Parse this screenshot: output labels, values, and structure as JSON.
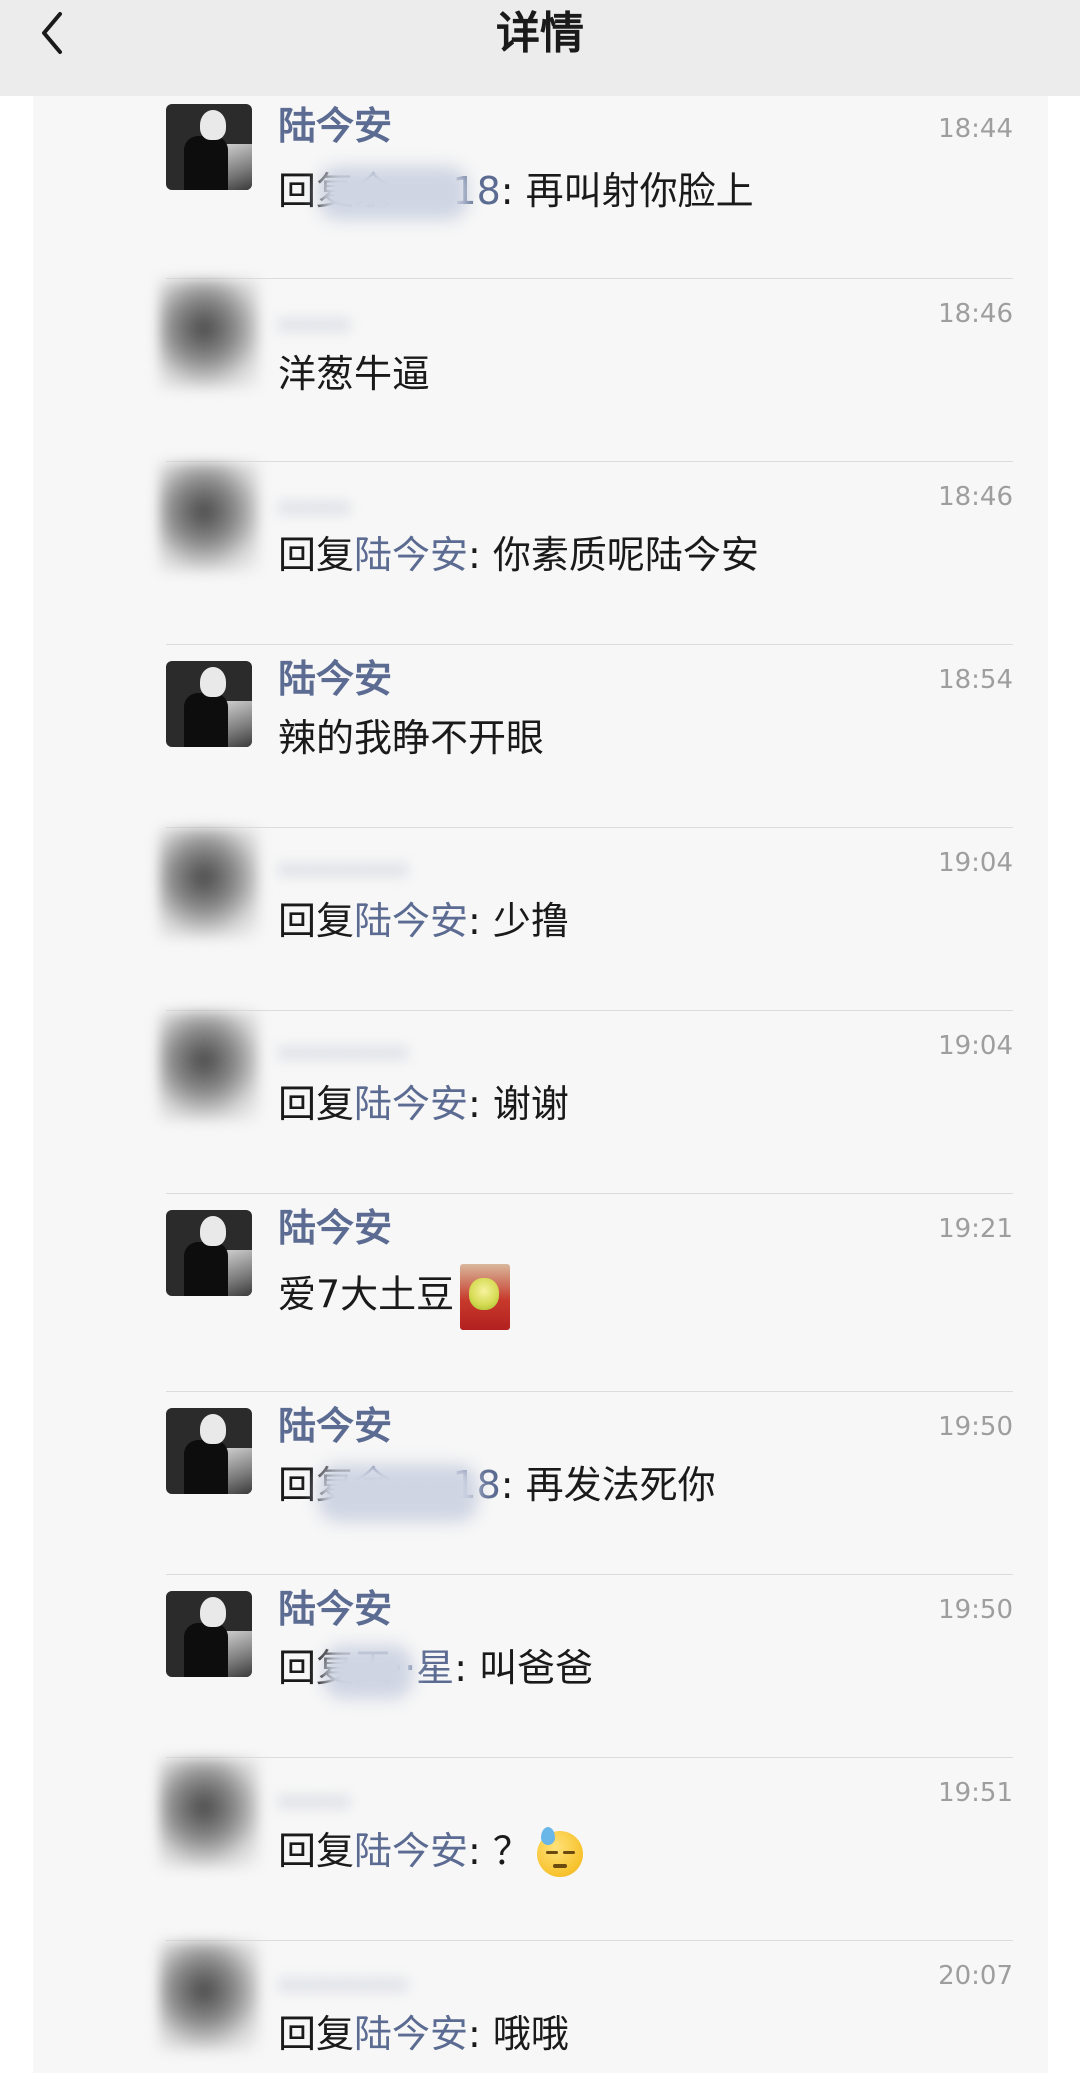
{
  "header": {
    "title": "详情",
    "back_icon": "chevron-left-icon"
  },
  "colors": {
    "username": "#5b6b91",
    "timestamp": "#9e9e9e",
    "text": "#1a1a1a",
    "panel": "#f7f7f7",
    "header": "#ececec"
  },
  "comments": [
    {
      "user": "陆今安",
      "time": "18:44",
      "prefix": "回复",
      "mention": "余·····18",
      "suffix": ": 再叫射你脸上"
    },
    {
      "user": "·····",
      "time": "18:46",
      "text": "洋葱牛逼"
    },
    {
      "user": "·····",
      "time": "18:46",
      "prefix": "回复",
      "mention": "陆今安",
      "suffix": ": 你素质呢陆今安"
    },
    {
      "user": "陆今安",
      "time": "18:54",
      "text": "辣的我睁不开眼"
    },
    {
      "user": "·········",
      "time": "19:04",
      "prefix": "回复",
      "mention": "陆今安",
      "suffix": ": 少撸"
    },
    {
      "user": "·········",
      "time": "19:04",
      "prefix": "回复",
      "mention": "陆今安",
      "suffix": ": 谢谢"
    },
    {
      "user": "陆今安",
      "time": "19:21",
      "text": "爱7大土豆",
      "sticker": "potato-sticker"
    },
    {
      "user": "陆今安",
      "time": "19:50",
      "prefix": "回复",
      "mention": "余·····18",
      "suffix": ": 再发法死你"
    },
    {
      "user": "陆今安",
      "time": "19:50",
      "prefix": "回复",
      "mention": "天··星",
      "suffix": ": 叫爸爸"
    },
    {
      "user": "·····",
      "time": "19:51",
      "prefix": "回复",
      "mention": "陆今安",
      "suffix": ": ？",
      "emoji": "sweat-emoji"
    },
    {
      "user": "·········",
      "time": "20:07",
      "prefix": "回复",
      "mention": "陆今安",
      "suffix": ": 哦哦"
    }
  ]
}
